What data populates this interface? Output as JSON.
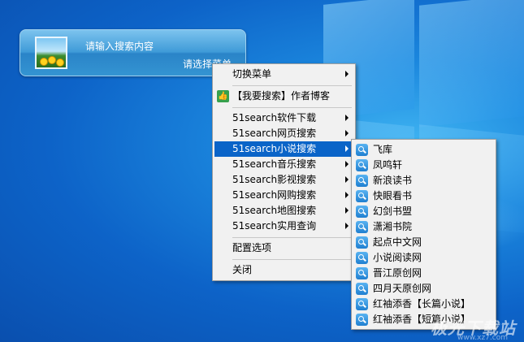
{
  "widget": {
    "placeholder": "请输入搜索内容",
    "select_label": "请选择菜单"
  },
  "menu": {
    "switch_menu": "切换菜单",
    "blog": "【我要搜索】作者博客",
    "categories": [
      "51search软件下载",
      "51search网页搜索",
      "51search小说搜索",
      "51search音乐搜索",
      "51search影视搜索",
      "51search网购搜索",
      "51search地图搜索",
      "51search实用查询"
    ],
    "config": "配置选项",
    "close": "关闭"
  },
  "submenu": {
    "items": [
      "飞库",
      "凤鸣轩",
      "新浪读书",
      "快眼看书",
      "幻剑书盟",
      "潇湘书院",
      "起点中文网",
      "小说阅读网",
      "晋江原创网",
      "四月天原创网",
      "红袖添香【长篇小说】",
      "红袖添香【短篇小说】"
    ]
  },
  "watermark": {
    "text": "极光下载站",
    "url": "www.xz7.com"
  },
  "colors": {
    "highlight": "#0a64c8",
    "menu_bg": "#f1f1f1"
  }
}
